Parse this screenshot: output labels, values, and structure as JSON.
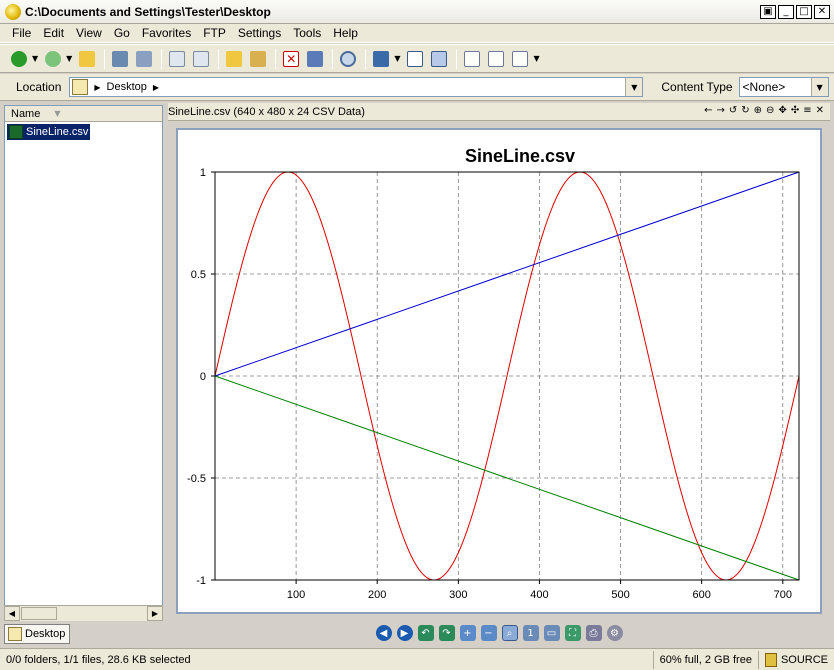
{
  "window": {
    "title": "C:\\Documents and Settings\\Tester\\Desktop"
  },
  "menu": [
    "File",
    "Edit",
    "View",
    "Go",
    "Favorites",
    "FTP",
    "Settings",
    "Tools",
    "Help"
  ],
  "location": {
    "label": "Location",
    "crumb": "Desktop"
  },
  "content_type": {
    "label": "Content Type",
    "value": "<None>"
  },
  "left_pane": {
    "column": "Name",
    "files": [
      "SineLine.csv"
    ],
    "tab": "Desktop"
  },
  "viewer": {
    "title": "SineLine.csv (640 x 480 x 24 CSV Data)"
  },
  "status": {
    "left": "0/0 folders, 1/1 files, 28.6 KB selected",
    "disk": "60% full, 2 GB free",
    "mode": "SOURCE"
  },
  "colors": {
    "sine": "#e00000",
    "rise": "#0000d0",
    "fall": "#008000",
    "grid": "#808080"
  },
  "chart_data": {
    "type": "line",
    "title": "SineLine.csv",
    "xlim": [
      0,
      720
    ],
    "ylim": [
      -1,
      1
    ],
    "x_ticks": [
      100,
      200,
      300,
      400,
      500,
      600,
      700
    ],
    "y_ticks": [
      1,
      0.5,
      0,
      -0.5,
      -1
    ],
    "grid": true,
    "series": [
      {
        "function": "sin(x deg)",
        "x": [
          0,
          45,
          90,
          135,
          180,
          225,
          270,
          315,
          360,
          405,
          450,
          495,
          540,
          585,
          630,
          675,
          720
        ],
        "values": [
          0,
          0.707,
          1,
          0.707,
          0,
          -0.707,
          -1,
          -0.707,
          0,
          0.707,
          1,
          0.707,
          0,
          -0.707,
          -1,
          -0.707,
          0
        ]
      },
      {
        "x": [
          0,
          720
        ],
        "values": [
          0,
          1
        ]
      },
      {
        "x": [
          0,
          720
        ],
        "values": [
          0,
          -1
        ]
      }
    ]
  }
}
